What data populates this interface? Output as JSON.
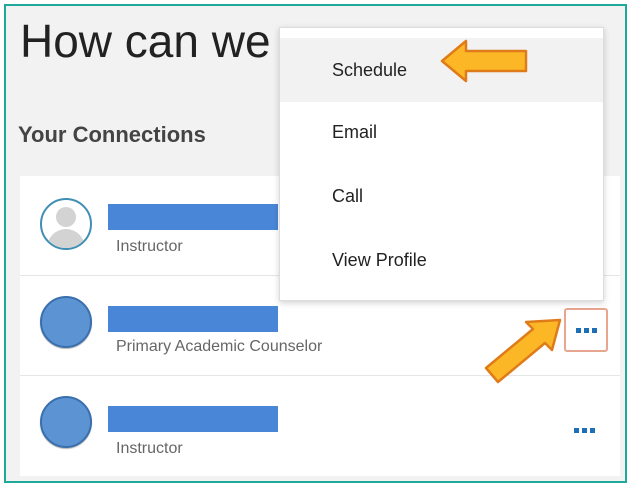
{
  "page": {
    "heading": "How can we",
    "section_title": "Your Connections"
  },
  "connections": [
    {
      "role": "Instructor",
      "avatar": "default-user-avatar-icon"
    },
    {
      "role": "Primary Academic Counselor",
      "avatar": "blue-circle-avatar"
    },
    {
      "role": "Instructor",
      "avatar": "blue-circle-avatar"
    }
  ],
  "menu": {
    "items": [
      {
        "label": "Schedule"
      },
      {
        "label": "Email"
      },
      {
        "label": "Call"
      },
      {
        "label": "View Profile"
      }
    ]
  },
  "icons": {
    "more": "more-options-icon",
    "annotation_arrow": "arrow-pointer-icon"
  },
  "colors": {
    "frame_border": "#1fa99b",
    "redaction": "#4a86d8",
    "dots": "#1f6fb6",
    "arrow_fill": "#fbb726",
    "arrow_stroke": "#e07b1a",
    "active_button_border": "#e8a58f"
  }
}
